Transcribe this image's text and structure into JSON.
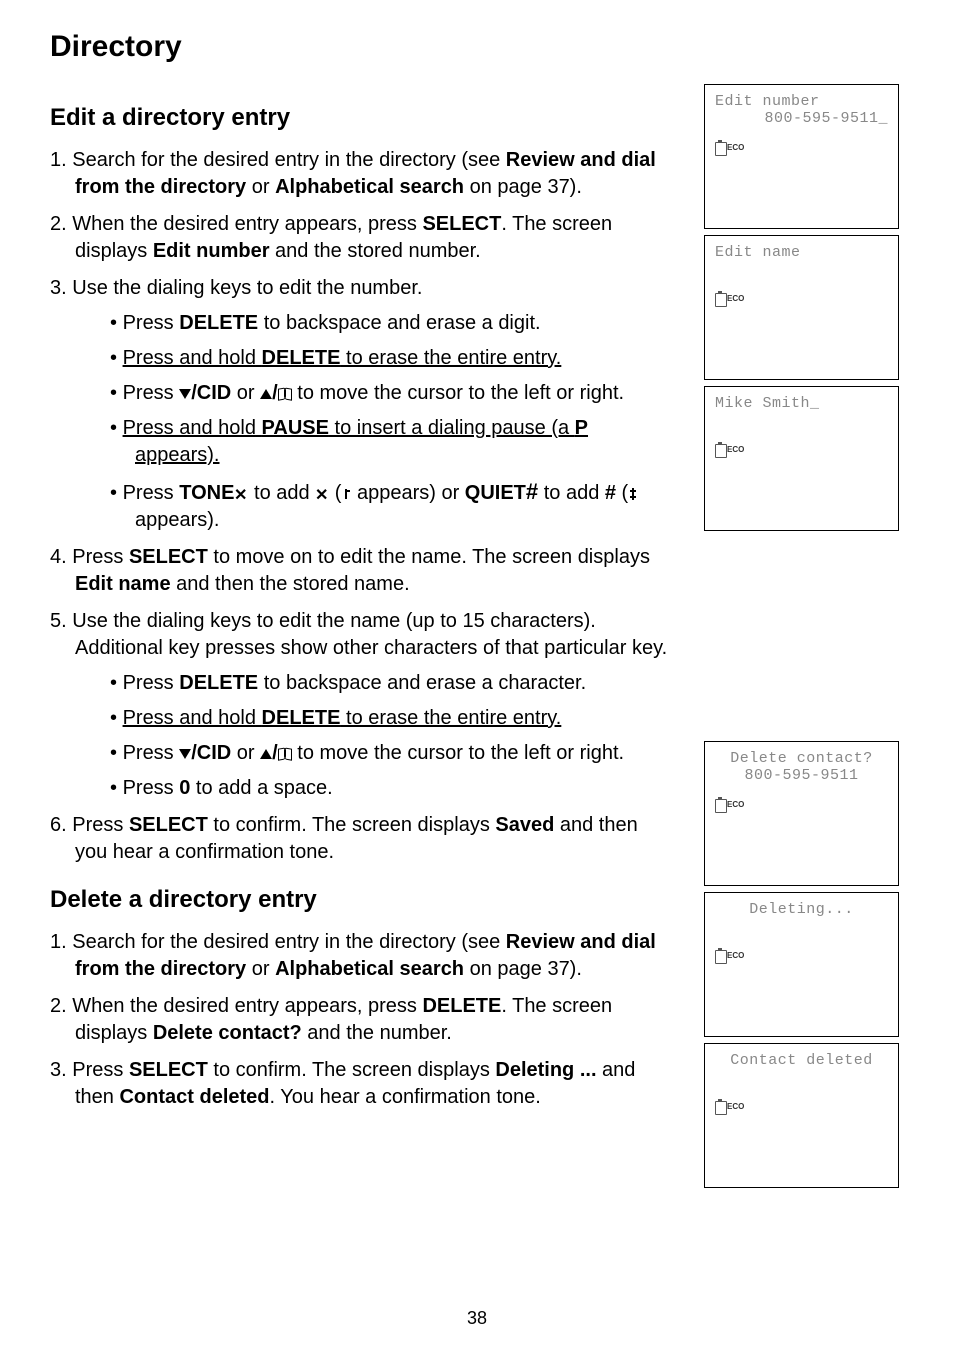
{
  "pageTitle": "Directory",
  "section1": {
    "title": "Edit a directory entry",
    "step1": {
      "prefix": "Search for the desired entry in the directory (see ",
      "boldPart": "Review and dial from the directory",
      "or": " or ",
      "boldPart2": "Alphabetical search",
      "suffix": " on page 37)."
    },
    "step2": {
      "prefix": "When the desired entry appears, press ",
      "bold1": "SELECT",
      "mid": ". The screen displays ",
      "bold2": "Edit number",
      "suffix": " and the stored number."
    },
    "step3": {
      "text": "Use the dialing keys to edit the number.",
      "bullets": {
        "b1": {
          "prefix": "Press ",
          "bold": "DELETE",
          "suffix": " to backspace and erase a digit."
        },
        "b2": {
          "underlinePrefix": "Press and hold",
          "space": " ",
          "bold": "DELETE",
          "underlineSuffix": " to erase the entire entry."
        },
        "b3": {
          "prefix": "Press ",
          "bold1": "/CID",
          "mid": " or ",
          "bold2": "/",
          "suffix": " to move the cursor to the left or right."
        },
        "b4": {
          "underlinePrefix": "Press and hold",
          "space": " ",
          "bold": "PAUSE",
          "underlineSuffix": " to insert a dialing pause (a ",
          "boldP": "P",
          "underlineEnd": " appears)."
        },
        "b5": {
          "prefix": "Press ",
          "bold1": "TONE",
          "mid1": " to add ",
          "appears1": " (",
          "appearsText1": " appears) or ",
          "bold2": "QUIET",
          "mid2": " to add ",
          "hashText": "#",
          "paren": " (",
          "appearsText2": " appears)."
        }
      }
    },
    "step4": {
      "prefix": " Press ",
      "bold1": "SELECT",
      "mid": " to move on to edit the name. The screen displays ",
      "bold2": "Edit name",
      "suffix": " and then the stored name."
    },
    "step5": {
      "text": "Use the dialing keys to edit the name (up to 15 characters). Additional key presses show other characters of that particular key.",
      "bullets": {
        "b1": {
          "prefix": "Press ",
          "bold": "DELETE",
          "suffix": " to backspace and erase a character."
        },
        "b2": {
          "underlinePrefix": "Press and hold",
          "space": " ",
          "bold": "DELETE",
          "underlineSuffix": " to erase the entire entry."
        },
        "b3": {
          "prefix": "Press ",
          "bold1": "/CID",
          "mid": " or ",
          "bold2": "/",
          "suffix": " to move the cursor to the left or right."
        },
        "b4": {
          "prefix": "Press ",
          "bold": "0",
          "suffix": " to add a space."
        }
      }
    },
    "step6": {
      "prefix": "Press ",
      "bold1": "SELECT",
      "mid": " to confirm. The screen displays ",
      "bold2": "Saved",
      "suffix": " and then you hear a confirmation tone."
    }
  },
  "section2": {
    "title": "Delete a directory entry",
    "step1": {
      "prefix": "Search for the desired entry in the directory (see ",
      "boldPart": "Review and dial from the directory",
      "or": " or ",
      "boldPart2": "Alphabetical search",
      "suffix": " on page 37)."
    },
    "step2": {
      "prefix": "When the desired entry appears, press ",
      "bold1": "DELETE",
      "mid": ". The screen displays ",
      "bold2": "Delete contact?",
      "suffix": " and the number."
    },
    "step3": {
      "prefix": "Press ",
      "bold1": "SELECT",
      "mid": " to confirm. The screen displays ",
      "bold2": "Deleting ...",
      "mid2": " and then ",
      "bold3": "Contact deleted",
      "suffix": ". You hear a confirmation tone."
    }
  },
  "screens": {
    "s1": {
      "line1": "Edit number",
      "line2": "800-595-9511_",
      "eco": "ECO"
    },
    "s2": {
      "line1": "Edit name",
      "eco": "ECO"
    },
    "s3": {
      "line1": "Mike Smith_",
      "eco": "ECO"
    },
    "s4": {
      "line1": "Delete contact?",
      "line2": "800-595-9511",
      "eco": "ECO"
    },
    "s5": {
      "line1": "Deleting...",
      "eco": "ECO"
    },
    "s6": {
      "line1": "Contact deleted",
      "eco": "ECO"
    }
  },
  "pageNumber": "38"
}
